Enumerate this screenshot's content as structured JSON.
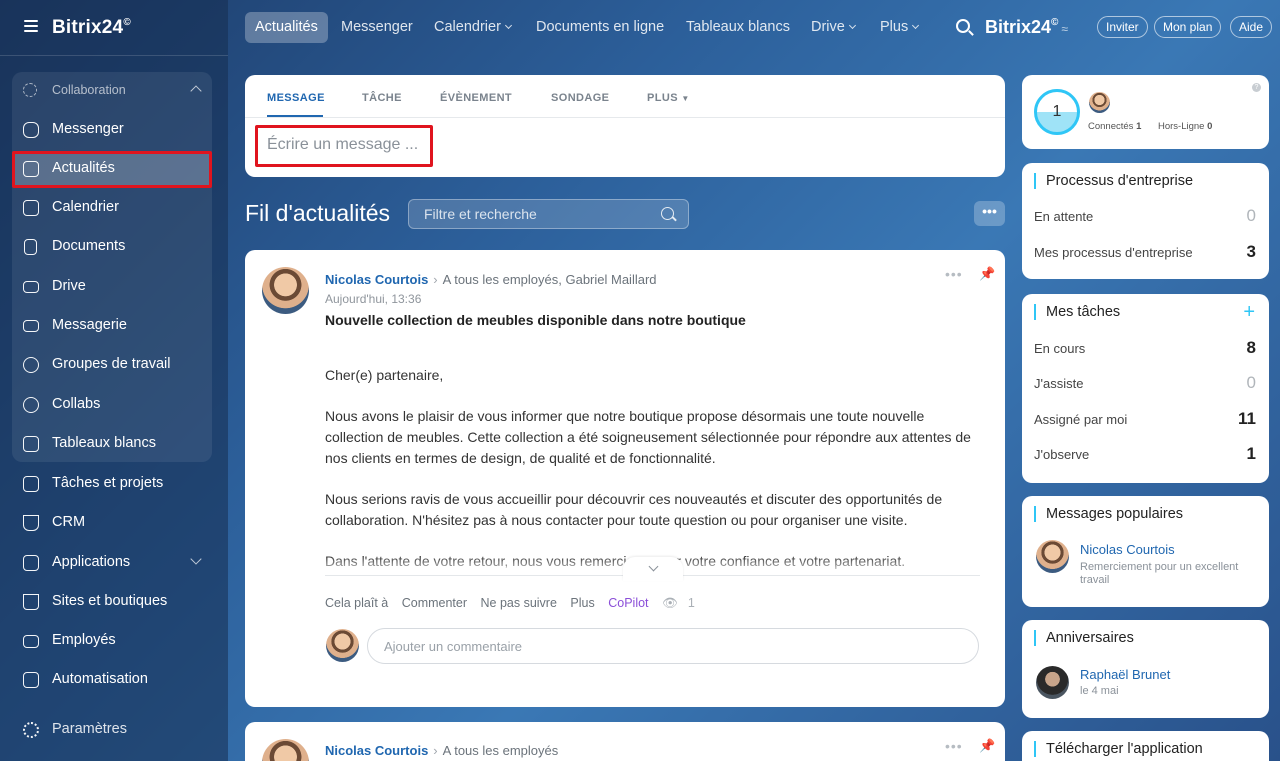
{
  "sidebar": {
    "logo": "Bitrix24",
    "logo_mark": "©",
    "group_label": "Collaboration",
    "items": [
      {
        "label": "Messenger"
      },
      {
        "label": "Actualités"
      },
      {
        "label": "Calendrier"
      },
      {
        "label": "Documents"
      },
      {
        "label": "Drive"
      },
      {
        "label": "Messagerie"
      },
      {
        "label": "Groupes de travail"
      },
      {
        "label": "Collabs"
      },
      {
        "label": "Tableaux blancs"
      },
      {
        "label": "Tâches et projets"
      },
      {
        "label": "CRM"
      },
      {
        "label": "Applications"
      },
      {
        "label": "Sites et boutiques"
      },
      {
        "label": "Employés"
      },
      {
        "label": "Automatisation"
      },
      {
        "label": "Paramètres"
      }
    ]
  },
  "topbar": {
    "tabs": [
      "Actualités",
      "Messenger",
      "Calendrier",
      "Documents en ligne",
      "Tableaux blancs",
      "Drive",
      "Plus"
    ],
    "logo": "Bitrix24",
    "logo_mark": "©",
    "logo_wave": "≈",
    "invite": "Inviter",
    "plan": "Mon plan",
    "help": "Aide"
  },
  "composer": {
    "tabs": [
      "MESSAGE",
      "TÂCHE",
      "ÉVÈNEMENT",
      "SONDAGE",
      "PLUS"
    ],
    "placeholder": "Écrire un message ..."
  },
  "feed": {
    "title": "Fil d'actualités",
    "filter_placeholder": "Filtre et recherche",
    "more": "•••"
  },
  "post": {
    "author": "Nicolas Courtois",
    "recipients": "A tous les employés, Gabriel Maillard",
    "date": "Aujourd'hui, 13:36",
    "title": "Nouvelle collection de meubles disponible dans notre boutique",
    "greeting": "Cher(e) partenaire,",
    "para1": "Nous avons le plaisir de vous informer que notre boutique propose désormais une toute nouvelle collection de meubles. Cette collection a été soigneusement sélectionnée pour répondre aux attentes de nos clients en termes de design, de qualité et de fonctionnalité.",
    "para2": "Nous serions ravis de vous accueillir pour découvrir ces nouveautés et discuter des opportunités de collaboration. N'hésitez pas à nous contacter pour toute question ou pour organiser une visite.",
    "para3": "Dans l'attente de votre retour, nous vous remercions pour votre confiance et votre partenariat.",
    "actions": {
      "like": "Cela plaît à",
      "comment": "Commenter",
      "unfollow": "Ne pas suivre",
      "more": "Plus",
      "copilot": "CoPilot",
      "views": "1"
    },
    "comment_placeholder": "Ajouter un commentaire"
  },
  "post2": {
    "author": "Nicolas Courtois",
    "recipients": "A tous les employés"
  },
  "online": {
    "count": "1",
    "connected_label": "Connectés",
    "connected": "1",
    "offline_label": "Hors-Ligne",
    "offline": "0"
  },
  "processes": {
    "title": "Processus d'entreprise",
    "rows": [
      {
        "label": "En attente",
        "value": "0"
      },
      {
        "label": "Mes processus d'entreprise",
        "value": "3"
      }
    ]
  },
  "tasks": {
    "title": "Mes tâches",
    "rows": [
      {
        "label": "En cours",
        "value": "8"
      },
      {
        "label": "J'assiste",
        "value": "0"
      },
      {
        "label": "Assigné par moi",
        "value": "11"
      },
      {
        "label": "J'observe",
        "value": "1"
      }
    ]
  },
  "popular": {
    "title": "Messages populaires",
    "author": "Nicolas Courtois",
    "text": "Remerciement pour un excellent travail"
  },
  "birthdays": {
    "title": "Anniversaires",
    "name": "Raphaël Brunet",
    "date": "le 4 mai"
  },
  "download": {
    "title": "Télécharger l'application"
  }
}
